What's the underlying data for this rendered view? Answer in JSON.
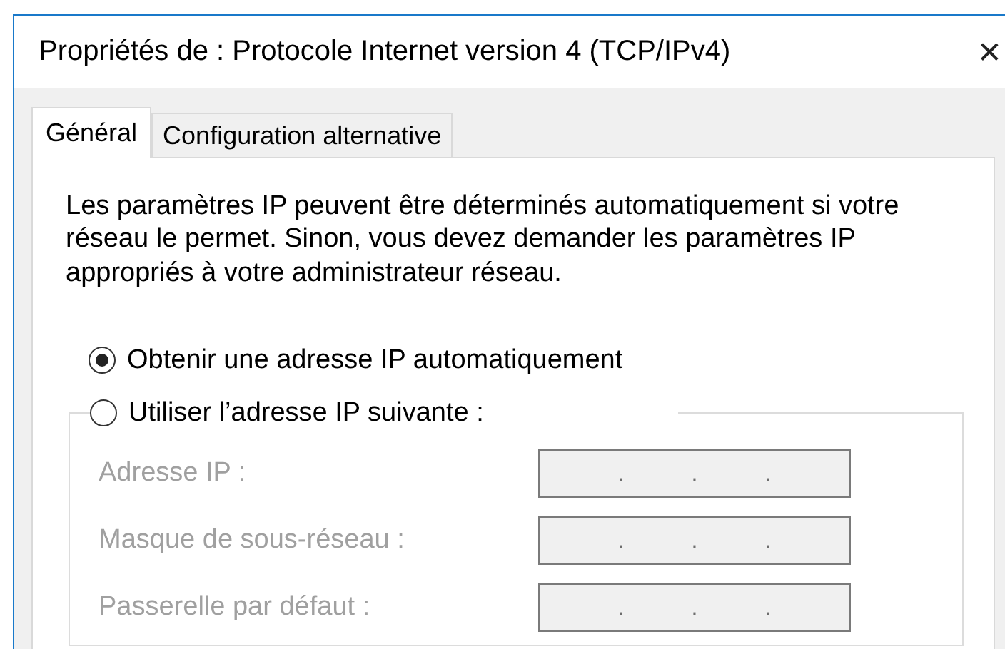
{
  "window": {
    "title": "Propriétés de : Protocole Internet version 4 (TCP/IPv4)",
    "close": "✕"
  },
  "tabs": [
    {
      "label": "Général",
      "selected": true
    },
    {
      "label": "Configuration alternative",
      "selected": false
    }
  ],
  "description": "Les paramètres IP peuvent être déterminés automatiquement si votre réseau le permet. Sinon, vous devez demander les paramètres IP appropriés à votre administrateur réseau.",
  "options": [
    {
      "label": "Obtenir une adresse IP automatiquement",
      "selected": true
    },
    {
      "label": "Utiliser l’adresse IP suivante :",
      "selected": false
    }
  ],
  "ip_fields": [
    {
      "label": "Adresse IP :",
      "disabled": true,
      "separators": [
        ".",
        ".",
        "."
      ]
    },
    {
      "label": "Masque de sous-réseau :",
      "disabled": true,
      "separators": [
        ".",
        ".",
        "."
      ]
    },
    {
      "label": "Passerelle par défaut :",
      "disabled": true,
      "separators": [
        ".",
        ".",
        "."
      ]
    }
  ]
}
